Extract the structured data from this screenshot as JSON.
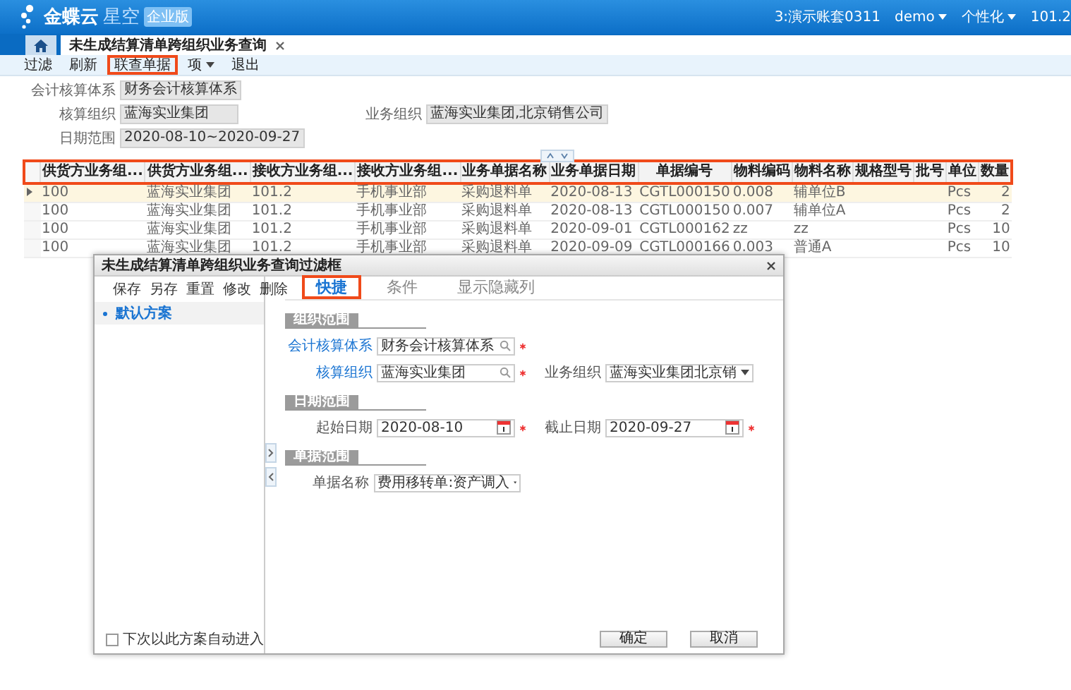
{
  "header": {
    "logo": {
      "brand": "金蝶云",
      "product": "星空",
      "edition": "企业版"
    },
    "menus": [
      {
        "label": "3:演示账套0311",
        "dropdown": false
      },
      {
        "label": "demo",
        "dropdown": true
      },
      {
        "label": "个性化",
        "dropdown": true
      },
      {
        "label": "101.2",
        "dropdown": false
      }
    ]
  },
  "tabs": [
    {
      "kind": "home",
      "selected": false,
      "closable": false
    },
    {
      "kind": "page",
      "label": "未生成结算清单跨组织业务查询",
      "selected": true,
      "closable": true
    }
  ],
  "toolbar": [
    {
      "label": "过滤",
      "highlighted": false,
      "dropdown": false
    },
    {
      "label": "刷新",
      "highlighted": false,
      "dropdown": false
    },
    {
      "label": "联查单据",
      "highlighted": true,
      "dropdown": false
    },
    {
      "label": "项",
      "highlighted": false,
      "dropdown": true
    },
    {
      "label": "退出",
      "highlighted": false,
      "dropdown": false
    }
  ],
  "summary": [
    [
      {
        "label": "会计核算体系",
        "value": "财务会计核算体系"
      }
    ],
    [
      {
        "label": "核算组织",
        "value": "蓝海实业集团"
      },
      {
        "label": "业务组织",
        "value": "蓝海实业集团,北京销售公司"
      }
    ],
    [
      {
        "label": "日期范围",
        "value": "2020-08-10~2020-09-27"
      }
    ]
  ],
  "table": {
    "header_highlighted": true,
    "columns": [
      "供货方业务组...",
      "供货方业务组...",
      "接收方业务组...",
      "接收方业务组...",
      "业务单据名称",
      "业务单据日期",
      "单据编号",
      "物料编码",
      "物料名称",
      "规格型号",
      "批号",
      "单位",
      "数量"
    ],
    "rows": [
      {
        "selected": true,
        "cells": [
          "100",
          "蓝海实业集团",
          "101.2",
          "手机事业部",
          "采购退料单",
          "2020-08-13",
          "CGTL000150",
          "0.008",
          "辅单位B",
          null,
          null,
          "Pcs",
          "2"
        ]
      },
      {
        "selected": false,
        "cells": [
          "100",
          "蓝海实业集团",
          "101.2",
          "手机事业部",
          "采购退料单",
          "2020-08-13",
          "CGTL000150",
          "0.007",
          "辅单位A",
          null,
          null,
          "Pcs",
          "2"
        ]
      },
      {
        "selected": false,
        "cells": [
          "100",
          "蓝海实业集团",
          "101.2",
          "手机事业部",
          "采购退料单",
          "2020-09-01",
          "CGTL000162",
          "zz",
          "zz",
          null,
          null,
          "Pcs",
          "10"
        ]
      },
      {
        "selected": false,
        "cells": [
          "100",
          "蓝海实业集团",
          "101.2",
          "手机事业部",
          "采购退料单",
          "2020-09-09",
          "CGTL000166",
          "0.003",
          "普通A",
          null,
          null,
          "Pcs",
          "10"
        ]
      }
    ]
  },
  "dialog": {
    "title": "未生成结算清单跨组织业务查询过滤框",
    "scheme_toolbar": [
      "保存",
      "另存",
      "重置",
      "修改",
      "删除"
    ],
    "schemes": [
      {
        "label": "默认方案",
        "selected": true
      }
    ],
    "auto_enter": {
      "label": "下次以此方案自动进入",
      "checked": false
    },
    "tabs": [
      {
        "label": "快捷",
        "selected": true,
        "highlighted": true
      },
      {
        "label": "条件",
        "selected": false,
        "highlighted": false
      },
      {
        "label": "显示隐藏列",
        "selected": false,
        "highlighted": false
      }
    ],
    "sections": [
      {
        "title": "组织范围",
        "rows": [
          [
            {
              "kind": "lookup",
              "label": "会计核算体系",
              "link": true,
              "value": "财务会计核算体系",
              "required": true
            }
          ],
          [
            {
              "kind": "lookup",
              "label": "核算组织",
              "link": true,
              "value": "蓝海实业集团",
              "required": true
            },
            {
              "kind": "select",
              "label": "业务组织",
              "link": false,
              "value": "蓝海实业集团北京销",
              "required": false
            }
          ]
        ]
      },
      {
        "title": "日期范围",
        "rows": [
          [
            {
              "kind": "date",
              "label": "起始日期",
              "link": false,
              "value": "2020-08-10",
              "required": true
            },
            {
              "kind": "date",
              "label": "截止日期",
              "link": false,
              "value": "2020-09-27",
              "required": true
            }
          ]
        ]
      },
      {
        "title": "单据范围",
        "rows": [
          [
            {
              "kind": "select",
              "label": "单据名称",
              "link": false,
              "value": "费用移转单:资产调入",
              "required": false
            }
          ]
        ]
      }
    ],
    "buttons": [
      "确定",
      "取消"
    ]
  }
}
